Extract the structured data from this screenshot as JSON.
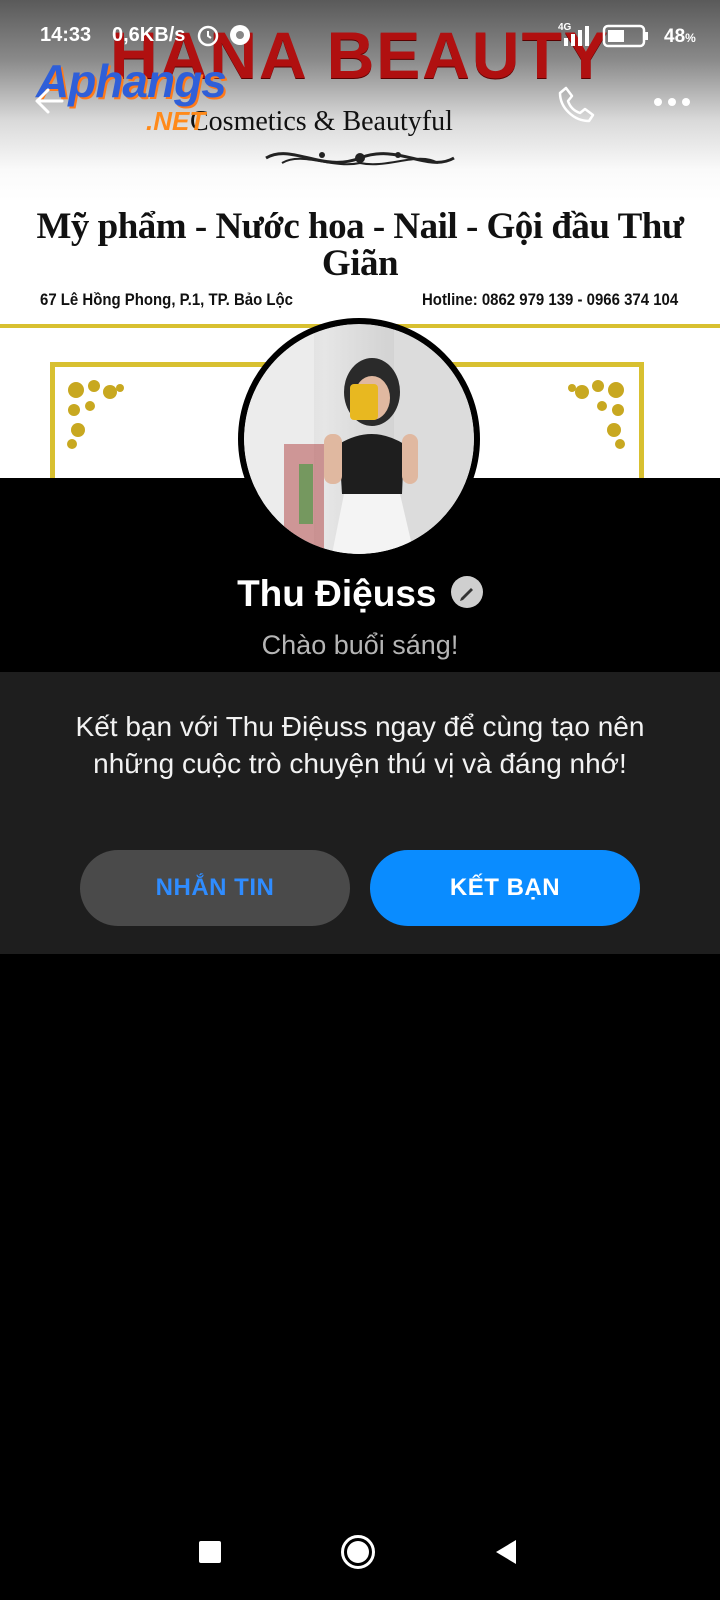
{
  "status_bar": {
    "time": "14:33",
    "net_speed": "0,6KB/s",
    "network": "4G",
    "battery_level": "48",
    "battery_unit": "%"
  },
  "cover": {
    "brand_title": "HANA BEAUTY",
    "brand_subtitle": "Cosmetics & Beautyful",
    "services": "Mỹ phẩm - Nước hoa - Nail - Gội đầu Thư Giãn",
    "address": "67 Lê Hồng Phong, P.1, TP. Bảo Lộc",
    "hotline": "Hotline: 0862 979 139  -  0966 374 104",
    "watermark": "Aphangs",
    "watermark_suffix": ".NET",
    "accent_gold": "#d8c030",
    "brand_red": "#b01010"
  },
  "top_bar": {
    "back_icon": "back-arrow-icon",
    "call_icon": "phone-icon",
    "more_icon": "more-horizontal-icon"
  },
  "profile": {
    "name": "Thu Điệuss",
    "edit_icon": "pencil-icon",
    "greeting": "Chào buổi sáng!"
  },
  "invite": {
    "text": "Kết bạn với Thu Điệuss ngay để cùng tạo nên những cuộc trò chuyện thú vị và đáng nhớ!",
    "message_button": "NHẮN TIN",
    "add_friend_button": "KẾT BẠN",
    "accent": "#0a8cff"
  },
  "nav_bar": {
    "recent_icon": "square-icon",
    "home_icon": "circle-icon",
    "back_icon": "triangle-back-icon"
  }
}
